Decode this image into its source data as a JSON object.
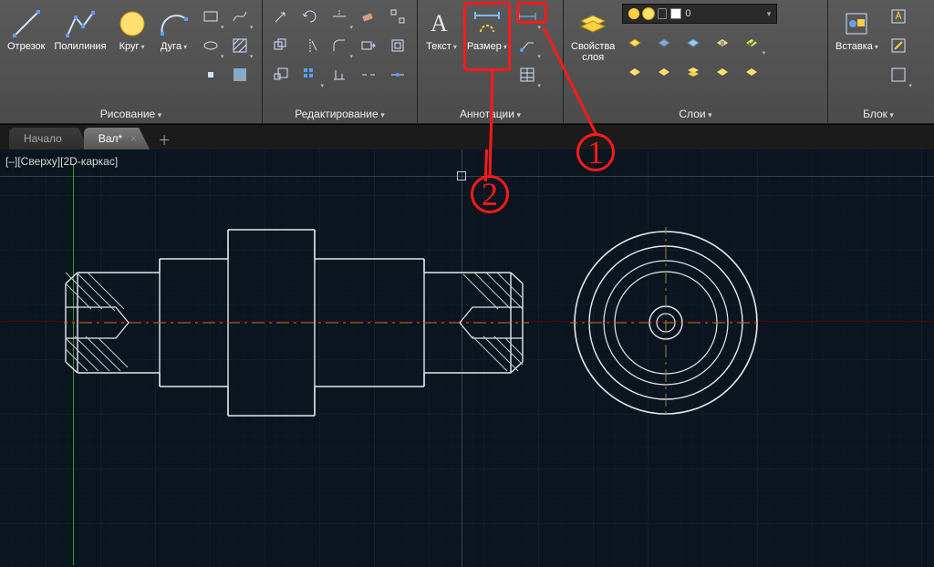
{
  "ribbon": {
    "draw": {
      "title": "Рисование",
      "line": "Отрезок",
      "polyline": "Полилиния",
      "circle": "Круг",
      "arc": "Дуга"
    },
    "modify": {
      "title": "Редактирование"
    },
    "annotation": {
      "title": "Аннотации",
      "text": "Текст",
      "dimension": "Размер"
    },
    "layers": {
      "title": "Слои",
      "props": "Свойства\nслоя",
      "current": "0"
    },
    "block": {
      "title": "Блок",
      "insert": "Вставка"
    }
  },
  "tabs": {
    "start": "Начало",
    "doc": "Вал*"
  },
  "viewport": {
    "label": "[–][Сверху][2D-каркас]"
  },
  "callouts": {
    "one": "1",
    "two": "2"
  }
}
